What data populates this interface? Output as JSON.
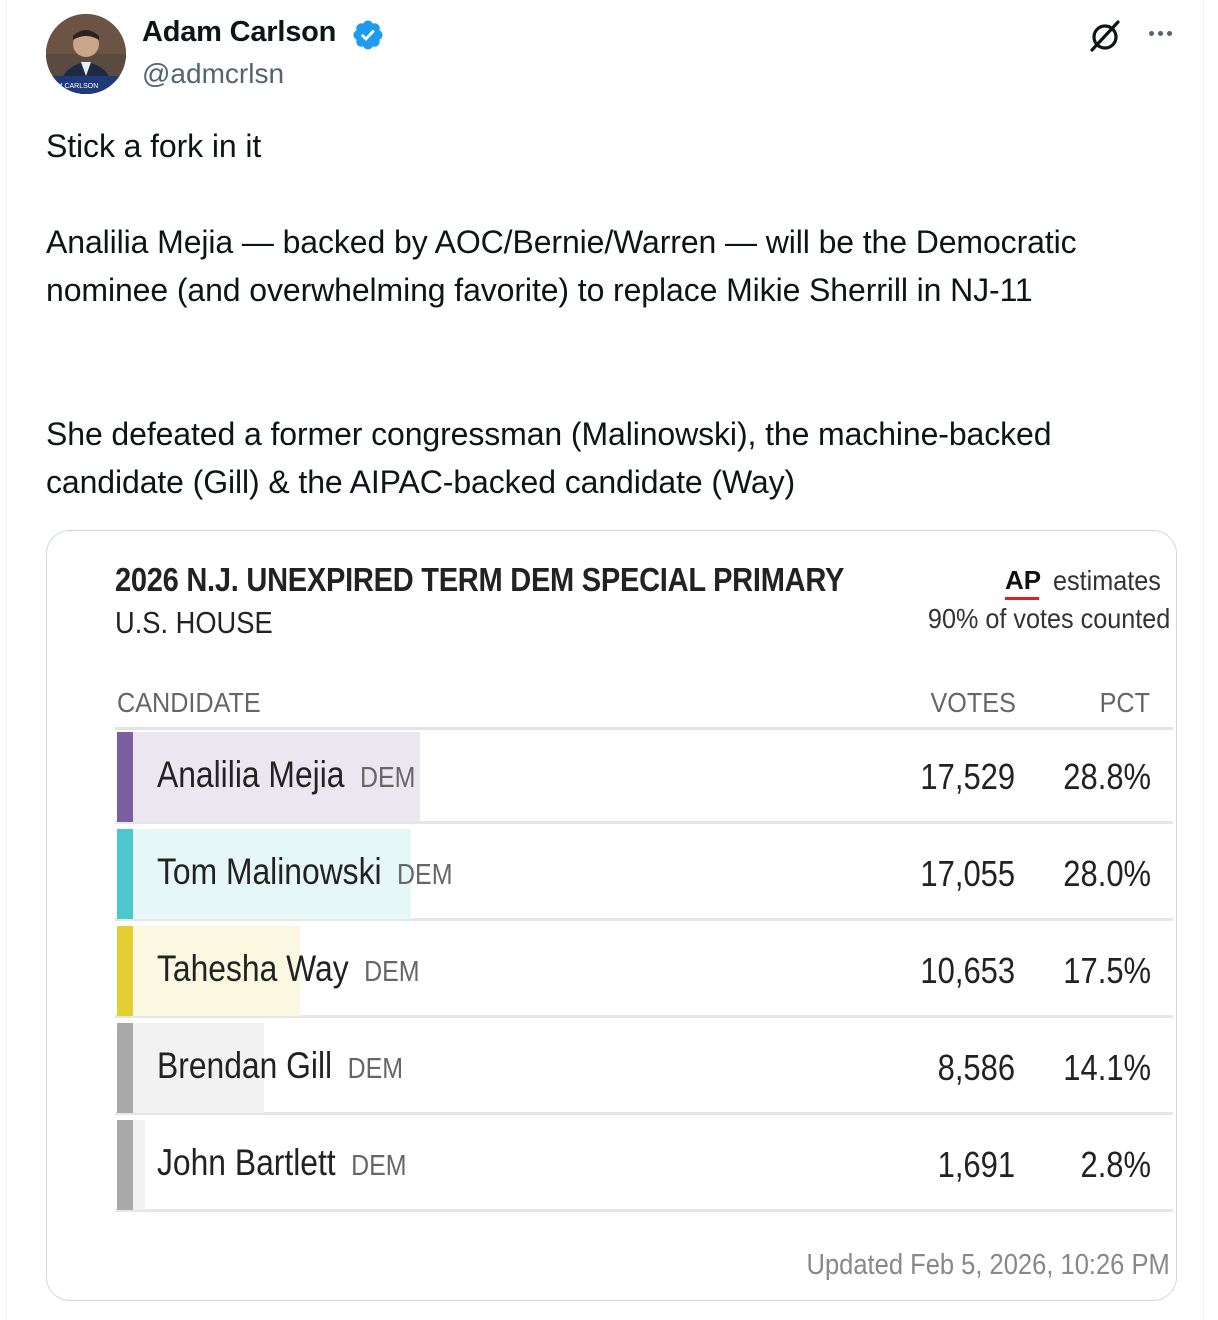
{
  "author": {
    "name": "Adam Carlson",
    "handle": "@admcrlsn",
    "verified": true,
    "avatar_caption": "AM CARLSON"
  },
  "tweet": {
    "line1": "Stick a fork in it",
    "para2": "Analilia Mejia — backed by AOC/Bernie/Warren — will be the Democratic nominee (and overwhelming favorite) to replace Mikie Sherrill in NJ-11",
    "para3": "She defeated a former congressman (Malinowski), the machine-backed candidate (Gill) & the AIPAC-backed candidate (Way)"
  },
  "results_card": {
    "title": "2026 N.J. UNEXPIRED TERM DEM SPECIAL PRIMARY",
    "subtitle": "U.S. HOUSE",
    "source_logo": "AP",
    "estimates_label": "estimates",
    "counted_label": "90% of votes counted",
    "columns": {
      "candidate": "CANDIDATE",
      "votes": "VOTES",
      "pct": "PCT"
    },
    "rows": [
      {
        "name": "Analilia Mejia",
        "party": "DEM",
        "votes": "17,529",
        "pct": "28.8%",
        "share": 28.8,
        "color": "#7b5ea0",
        "tint": "#ece6f1"
      },
      {
        "name": "Tom Malinowski",
        "party": "DEM",
        "votes": "17,055",
        "pct": "28.0%",
        "share": 28.0,
        "color": "#4cc7cc",
        "tint": "#e6f7f8"
      },
      {
        "name": "Tahesha Way",
        "party": "DEM",
        "votes": "10,653",
        "pct": "17.5%",
        "share": 17.5,
        "color": "#e3cf31",
        "tint": "#fbf8e1"
      },
      {
        "name": "Brendan Gill",
        "party": "DEM",
        "votes": "8,586",
        "pct": "14.1%",
        "share": 14.1,
        "color": "#a9a9a9",
        "tint": "#f2f2f2"
      },
      {
        "name": "John Bartlett",
        "party": "DEM",
        "votes": "1,691",
        "pct": "2.8%",
        "share": 2.8,
        "color": "#a9a9a9",
        "tint": "#f2f2f2"
      }
    ],
    "updated": "Updated Feb 5, 2026, 10:26 PM"
  }
}
